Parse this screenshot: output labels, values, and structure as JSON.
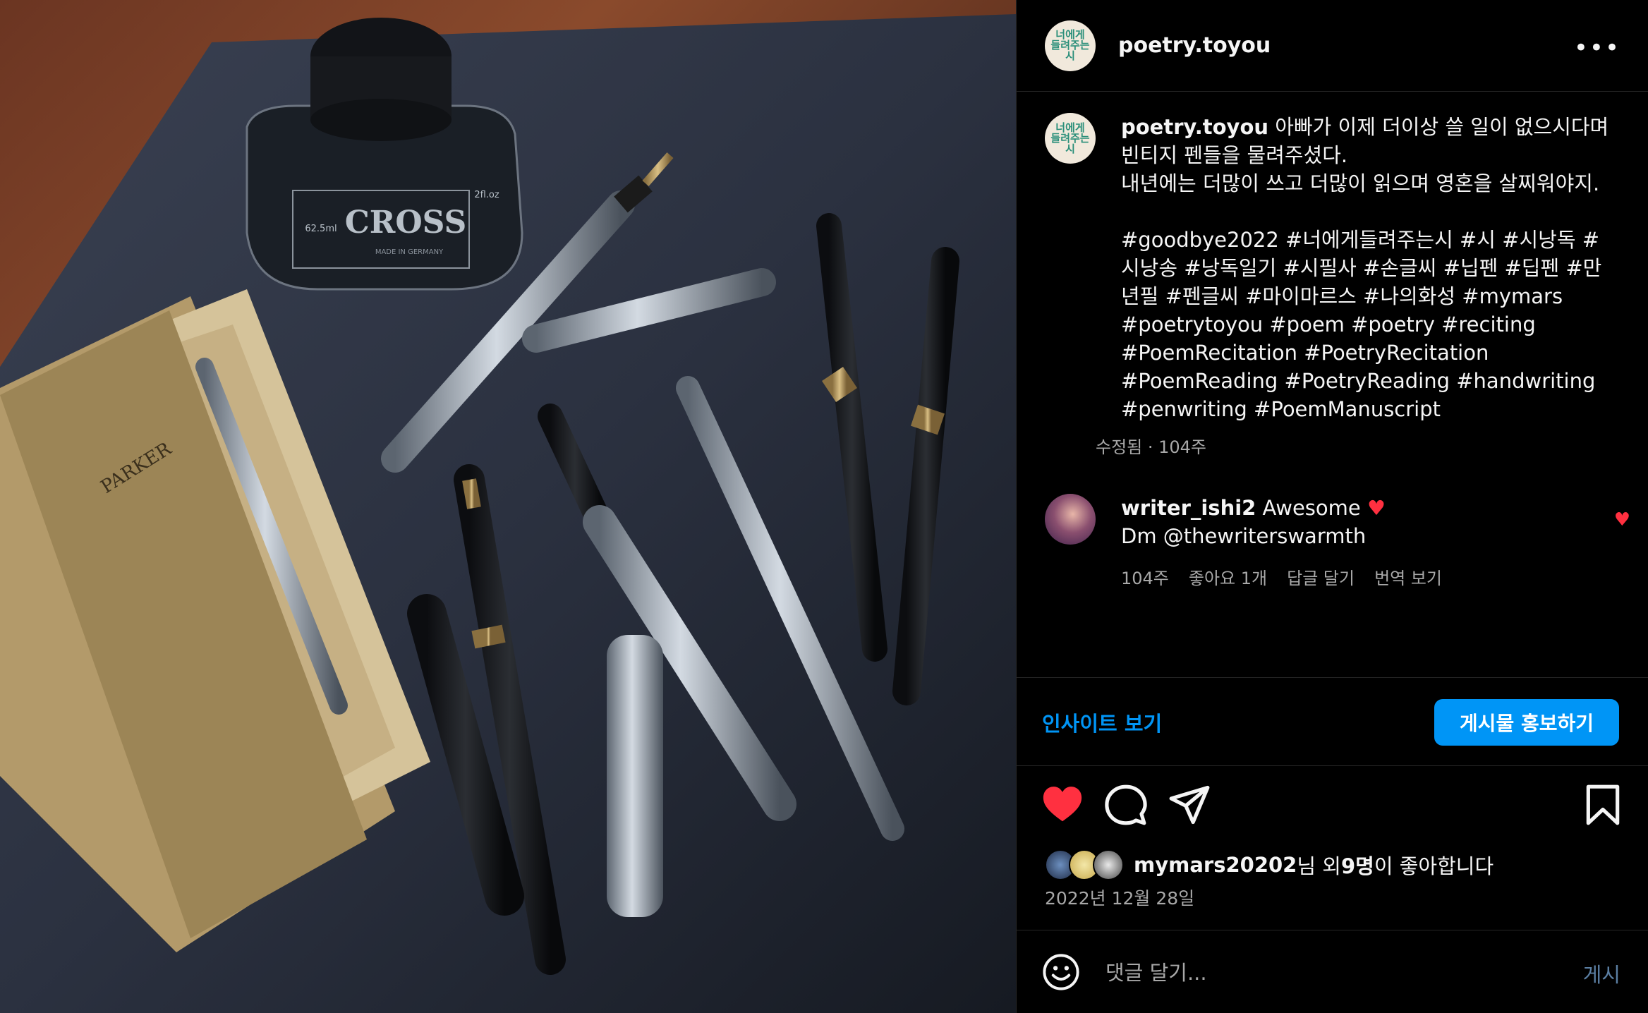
{
  "post": {
    "username": "poetry.toyou",
    "avatar_text": "너에게 들려주는 시",
    "caption_username": "poetry.toyou",
    "caption": " 아빠가 이제 더이상 쓸 일이 없으시다며\n빈티지 펜들을 물려주셨다.\n내년에는 더많이 쓰고 더많이 읽으며 영혼을 살찌워야지.\n\n#goodbye2022 #너에게들려주는시 #시 #시낭독 #시낭송 #낭독일기 #시필사 #손글씨 #닙펜 #딥펜 #만년필 #펜글씨 #마이마르스 #나의화성 #mymars #poetrytoyou #poem #poetry #reciting #PoemRecitation #PoetryRecitation #PoemReading #PoetryReading #handwriting #penwriting #PoemManuscript",
    "caption_meta": "수정됨 · 104주"
  },
  "photo": {
    "ink_brand": "CROSS",
    "ink_volume": "62.5ml",
    "ink_volume_oz": "2fl.oz",
    "ink_origin": "MADE IN GERMANY",
    "box_brand": "PARKER"
  },
  "comment": {
    "username": "writer_ishi2",
    "text": " Awesome ",
    "heart": "♥",
    "text2": "Dm @thewriterswarmth",
    "time": "104주",
    "likes": "좋아요 1개",
    "reply": "답글 달기",
    "translate": "번역 보기"
  },
  "insight": {
    "link_label": "인사이트 보기",
    "promote_label": "게시물 홍보하기"
  },
  "likes": {
    "name": "mymars20202",
    "mid": "님 외 ",
    "count": "9명",
    "suffix": "이 좋아합니다"
  },
  "date": "2022년 12월 28일",
  "comment_box": {
    "placeholder": "댓글 달기...",
    "post_label": "게시"
  },
  "colors": {
    "accent": "#0095f6",
    "like": "#ff3040",
    "muted": "#a8a8a8",
    "divider": "#262626"
  },
  "icons": [
    "more-icon",
    "heart-icon",
    "comment-icon",
    "share-icon",
    "bookmark-icon",
    "emoji-icon"
  ]
}
